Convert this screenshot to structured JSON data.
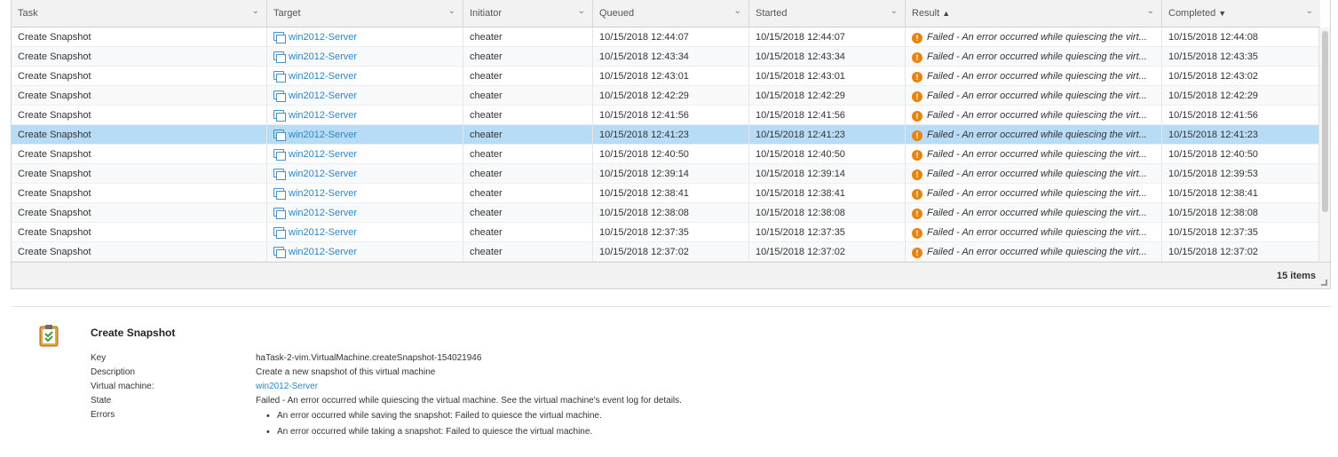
{
  "table": {
    "columns": [
      {
        "key": "task",
        "label": "Task",
        "sort": ""
      },
      {
        "key": "target",
        "label": "Target",
        "sort": ""
      },
      {
        "key": "initiator",
        "label": "Initiator",
        "sort": ""
      },
      {
        "key": "queued",
        "label": "Queued",
        "sort": ""
      },
      {
        "key": "started",
        "label": "Started",
        "sort": ""
      },
      {
        "key": "result",
        "label": "Result",
        "sort": "▲"
      },
      {
        "key": "completed",
        "label": "Completed",
        "sort": "▼"
      }
    ],
    "rows": [
      {
        "task": "Create Snapshot",
        "target": "win2012-Server",
        "initiator": "cheater",
        "queued": "10/15/2018 12:44:07",
        "started": "10/15/2018 12:44:07",
        "result": "Failed - An error occurred while quiescing the virt...",
        "completed": "10/15/2018 12:44:08",
        "selected": false
      },
      {
        "task": "Create Snapshot",
        "target": "win2012-Server",
        "initiator": "cheater",
        "queued": "10/15/2018 12:43:34",
        "started": "10/15/2018 12:43:34",
        "result": "Failed - An error occurred while quiescing the virt...",
        "completed": "10/15/2018 12:43:35",
        "selected": false
      },
      {
        "task": "Create Snapshot",
        "target": "win2012-Server",
        "initiator": "cheater",
        "queued": "10/15/2018 12:43:01",
        "started": "10/15/2018 12:43:01",
        "result": "Failed - An error occurred while quiescing the virt...",
        "completed": "10/15/2018 12:43:02",
        "selected": false
      },
      {
        "task": "Create Snapshot",
        "target": "win2012-Server",
        "initiator": "cheater",
        "queued": "10/15/2018 12:42:29",
        "started": "10/15/2018 12:42:29",
        "result": "Failed - An error occurred while quiescing the virt...",
        "completed": "10/15/2018 12:42:29",
        "selected": false
      },
      {
        "task": "Create Snapshot",
        "target": "win2012-Server",
        "initiator": "cheater",
        "queued": "10/15/2018 12:41:56",
        "started": "10/15/2018 12:41:56",
        "result": "Failed - An error occurred while quiescing the virt...",
        "completed": "10/15/2018 12:41:56",
        "selected": false
      },
      {
        "task": "Create Snapshot",
        "target": "win2012-Server",
        "initiator": "cheater",
        "queued": "10/15/2018 12:41:23",
        "started": "10/15/2018 12:41:23",
        "result": "Failed - An error occurred while quiescing the virt...",
        "completed": "10/15/2018 12:41:23",
        "selected": true
      },
      {
        "task": "Create Snapshot",
        "target": "win2012-Server",
        "initiator": "cheater",
        "queued": "10/15/2018 12:40:50",
        "started": "10/15/2018 12:40:50",
        "result": "Failed - An error occurred while quiescing the virt...",
        "completed": "10/15/2018 12:40:50",
        "selected": false
      },
      {
        "task": "Create Snapshot",
        "target": "win2012-Server",
        "initiator": "cheater",
        "queued": "10/15/2018 12:39:14",
        "started": "10/15/2018 12:39:14",
        "result": "Failed - An error occurred while quiescing the virt...",
        "completed": "10/15/2018 12:39:53",
        "selected": false
      },
      {
        "task": "Create Snapshot",
        "target": "win2012-Server",
        "initiator": "cheater",
        "queued": "10/15/2018 12:38:41",
        "started": "10/15/2018 12:38:41",
        "result": "Failed - An error occurred while quiescing the virt...",
        "completed": "10/15/2018 12:38:41",
        "selected": false
      },
      {
        "task": "Create Snapshot",
        "target": "win2012-Server",
        "initiator": "cheater",
        "queued": "10/15/2018 12:38:08",
        "started": "10/15/2018 12:38:08",
        "result": "Failed - An error occurred while quiescing the virt...",
        "completed": "10/15/2018 12:38:08",
        "selected": false
      },
      {
        "task": "Create Snapshot",
        "target": "win2012-Server",
        "initiator": "cheater",
        "queued": "10/15/2018 12:37:35",
        "started": "10/15/2018 12:37:35",
        "result": "Failed - An error occurred while quiescing the virt...",
        "completed": "10/15/2018 12:37:35",
        "selected": false
      },
      {
        "task": "Create Snapshot",
        "target": "win2012-Server",
        "initiator": "cheater",
        "queued": "10/15/2018 12:37:02",
        "started": "10/15/2018 12:37:02",
        "result": "Failed - An error occurred while quiescing the virt...",
        "completed": "10/15/2018 12:37:02",
        "selected": false
      }
    ],
    "item_count": "15 items",
    "target_icon": "virtual-machine-icon",
    "result_icon": "error-icon"
  },
  "detail": {
    "icon": "clipboard-check-icon",
    "title": "Create Snapshot",
    "fields": {
      "key_label": "Key",
      "key_value": "haTask-2-vim.VirtualMachine.createSnapshot-154021946",
      "description_label": "Description",
      "description_value": "Create a new snapshot of this virtual machine",
      "vm_label": "Virtual machine:",
      "vm_value": "win2012-Server",
      "state_label": "State",
      "state_value": "Failed - An error occurred while quiescing the virtual machine. See the virtual machine's event log for details.",
      "errors_label": "Errors"
    },
    "errors": [
      "An error occurred while saving the snapshot: Failed to quiesce the virtual machine.",
      "An error occurred while taking a snapshot: Failed to quiesce the virtual machine."
    ]
  },
  "colors": {
    "link": "#2b86c6",
    "selected_row": "#b8dcf5",
    "error_icon": "#e8830e"
  }
}
